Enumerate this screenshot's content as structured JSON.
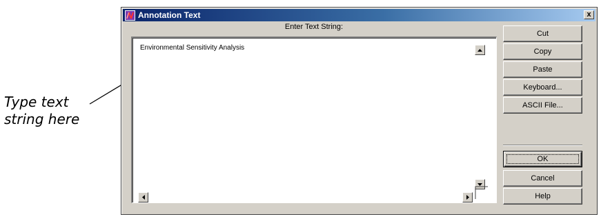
{
  "callout": {
    "line1": "Type text",
    "line2": "string here"
  },
  "window": {
    "title": "Annotation Text",
    "close_glyph": "x",
    "icon": "app-icon"
  },
  "prompt": {
    "label": "Enter Text String:"
  },
  "text_area": {
    "value": "Environmental Sensitivity Analysis"
  },
  "buttons": {
    "cut": "Cut",
    "copy": "Copy",
    "paste": "Paste",
    "keyboard": "Keyboard...",
    "ascii_file": "ASCII File...",
    "ok": "OK",
    "cancel": "Cancel",
    "help": "Help"
  },
  "colors": {
    "title_start": "#0a246a",
    "title_end": "#a6caf0",
    "face": "#d4d0c8"
  }
}
